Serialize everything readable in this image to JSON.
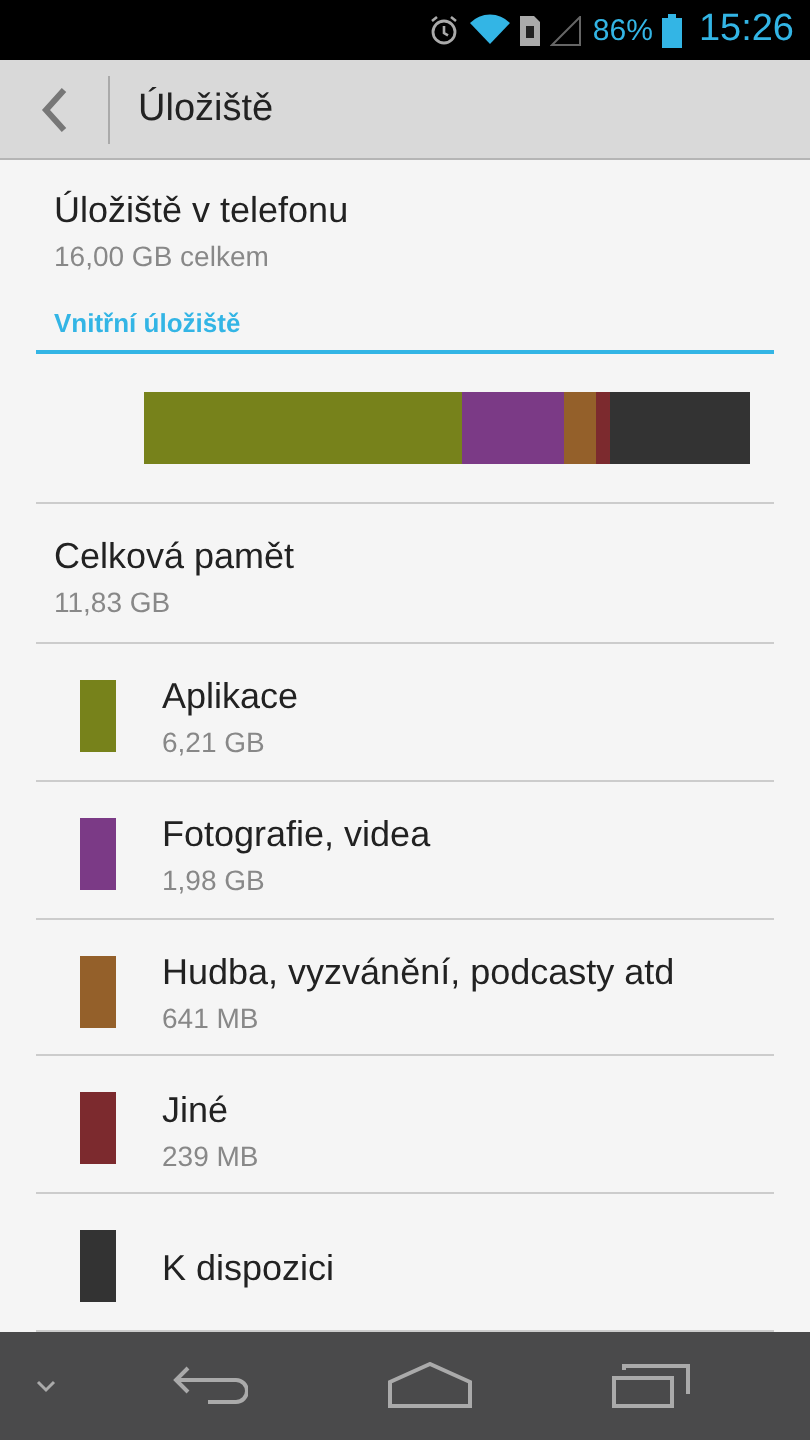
{
  "status_bar": {
    "battery": "86%",
    "time": "15:26"
  },
  "action_bar": {
    "title": "Úložiště"
  },
  "storage": {
    "title": "Úložiště v telefonu",
    "subtitle": "16,00  GB celkem"
  },
  "section": {
    "title": "Vnitřní úložiště"
  },
  "usage_bar": [
    {
      "color": "#77821b"
    },
    {
      "color": "#7b3a86"
    },
    {
      "color": "#94602a"
    },
    {
      "color": "#7c2a2e"
    },
    {
      "color": "#333333"
    }
  ],
  "total": {
    "title": "Celková pamět",
    "value": "11,83 GB"
  },
  "categories": [
    {
      "color": "#77821b",
      "title": "Aplikace",
      "size": "6,21 GB"
    },
    {
      "color": "#7b3a86",
      "title": "Fotografie, videa",
      "size": "1,98 GB"
    },
    {
      "color": "#94602a",
      "title": "Hudba, vyzvánění, podcasty atd",
      "size": "641 MB"
    },
    {
      "color": "#7c2a2e",
      "title": "Jiné",
      "size": "239 MB"
    },
    {
      "color": "#333333",
      "title": "K dispozici"
    }
  ]
}
